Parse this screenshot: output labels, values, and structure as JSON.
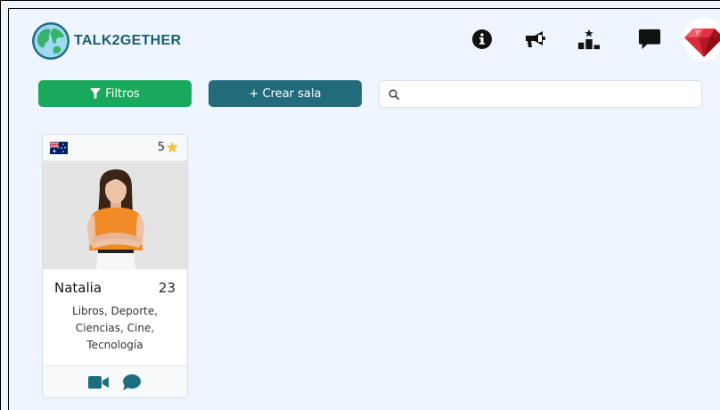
{
  "brand": {
    "name": "TALK2GETHER"
  },
  "nav": {
    "icons": [
      "info-icon",
      "megaphone-icon",
      "leaderboard-icon",
      "chat-icon",
      "gem-icon"
    ]
  },
  "toolbar": {
    "filter_label": "Filtros",
    "create_label": "+ Crear sala",
    "search_placeholder": ""
  },
  "colors": {
    "filter_button": "#1aa85c",
    "create_button": "#226b7b",
    "brand_text": "#1f5e6e",
    "background": "#eef5fe",
    "icon_teal": "#1f6e80",
    "star": "#f5c242"
  },
  "users": [
    {
      "country": "Australia",
      "rating": "5",
      "name": "Natalia",
      "age": "23",
      "interests": "Libros, Deporte, Ciencias, Cine, Tecnología",
      "actions": [
        "video-call-icon",
        "message-icon"
      ]
    }
  ]
}
